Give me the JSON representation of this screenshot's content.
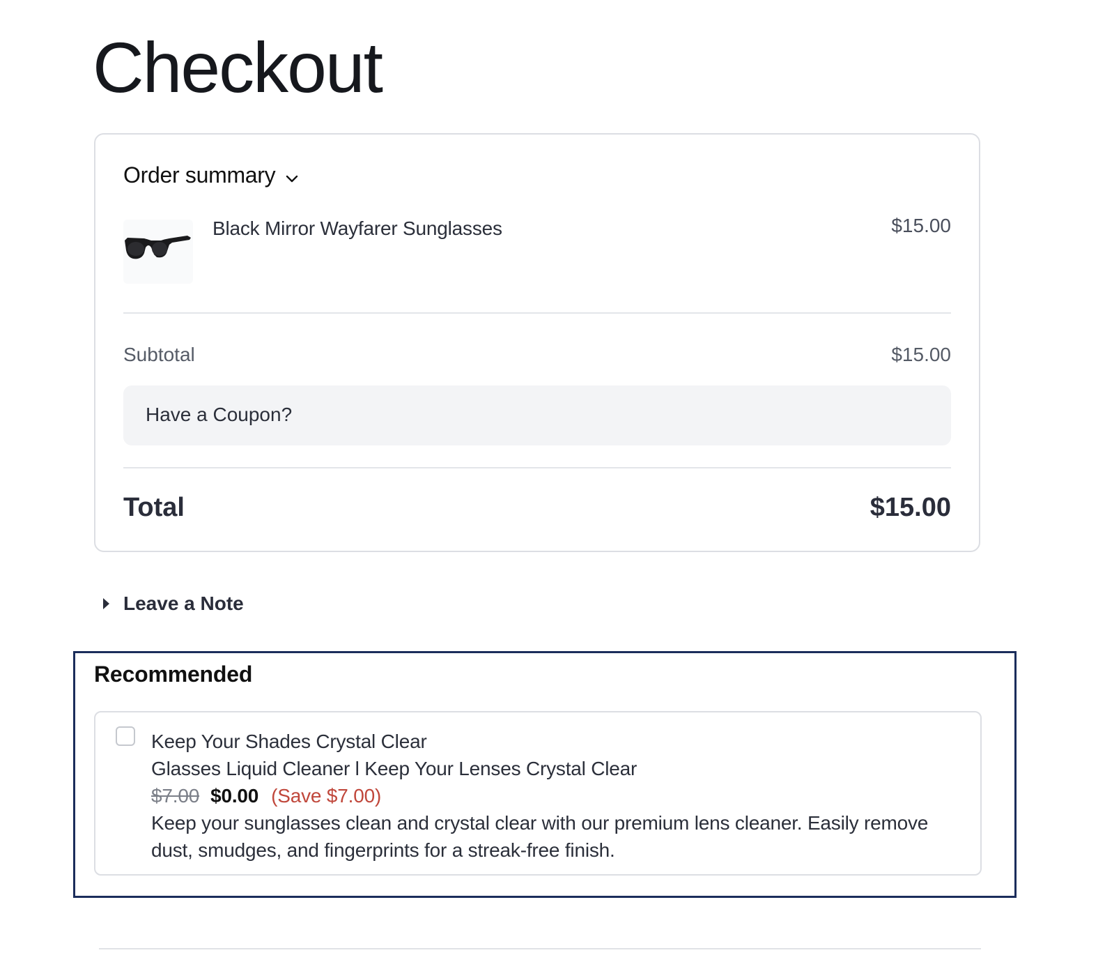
{
  "page": {
    "title": "Checkout"
  },
  "order_summary": {
    "title": "Order summary",
    "toggle_icon": "chevron-down-icon",
    "product": {
      "name": "Black Mirror Wayfarer Sunglasses",
      "price": "$15.00",
      "image": "sunglasses-icon"
    },
    "subtotal_label": "Subtotal",
    "subtotal_value": "$15.00",
    "coupon_label": "Have a Coupon?",
    "total_label": "Total",
    "total_value": "$15.00"
  },
  "note": {
    "label": "Leave a Note",
    "icon": "caret-right-icon"
  },
  "recommended": {
    "title": "Recommended",
    "item": {
      "headline": "Keep Your Shades Crystal Clear",
      "product_name": "Glasses Liquid Cleaner l Keep Your Lenses Crystal Clear",
      "old_price": "$7.00",
      "new_price": "$0.00",
      "savings": "(Save $7.00)",
      "description": "Keep your sunglasses clean and crystal clear with our premium lens cleaner. Easily remove dust, smudges, and fingerprints for a streak-free finish.",
      "checked": false
    }
  },
  "colors": {
    "accent_border": "#1b2d5b",
    "savings_text": "#c0473b",
    "coupon_bg": "#f3f4f6",
    "card_border": "#dcdee3"
  }
}
